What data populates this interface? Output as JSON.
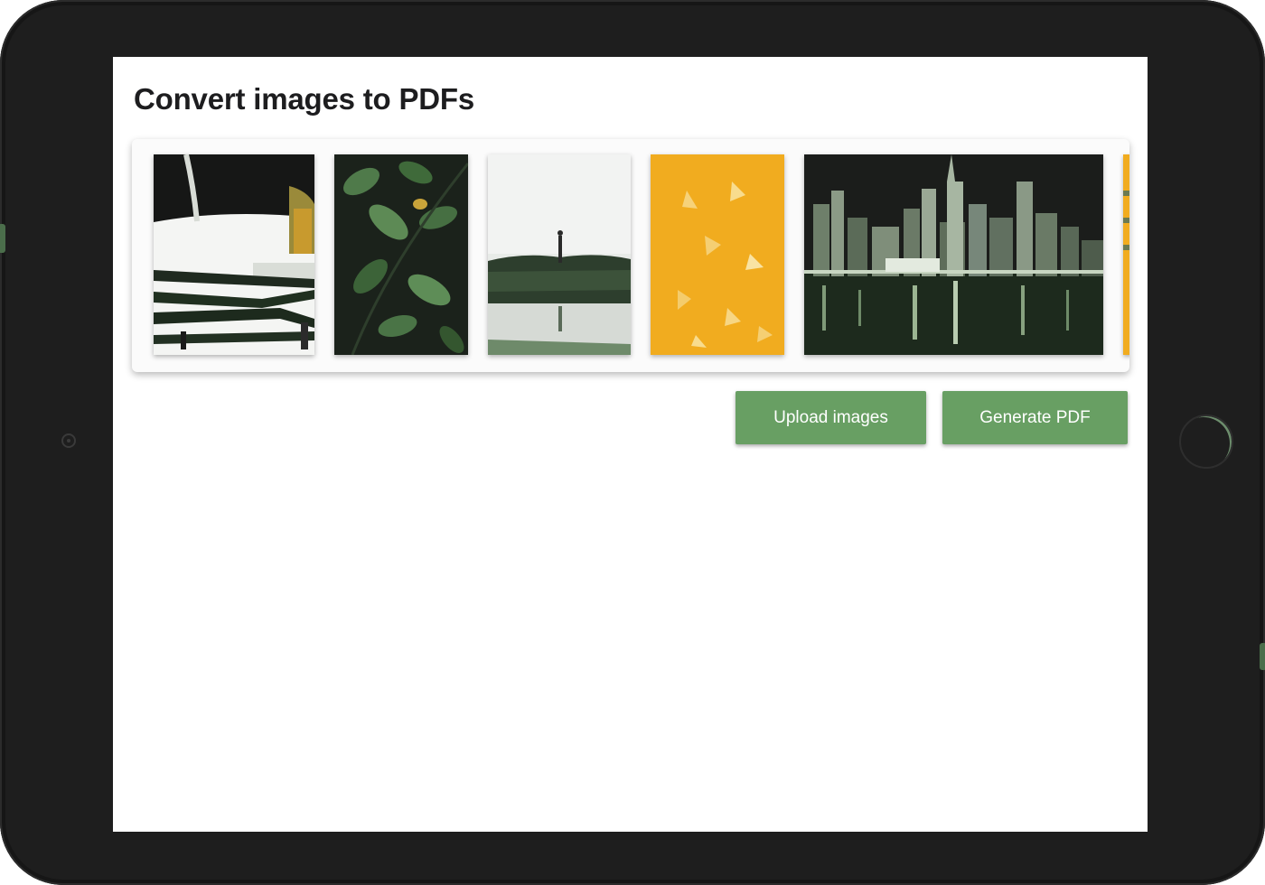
{
  "page": {
    "title": "Convert images to PDFs"
  },
  "gallery": {
    "thumbnails": [
      {
        "subject": "architecture-stairs"
      },
      {
        "subject": "leaves"
      },
      {
        "subject": "person-on-rocks-seaside"
      },
      {
        "subject": "yellow-leaves"
      },
      {
        "subject": "night-city-skyline"
      },
      {
        "subject": "yellow-partial"
      }
    ]
  },
  "actions": {
    "upload_label": "Upload images",
    "generate_label": "Generate PDF"
  },
  "colors": {
    "accent_button": "#689f63",
    "device_frame": "#1e1e1e",
    "photo_yellow": "#f1ac1f"
  }
}
